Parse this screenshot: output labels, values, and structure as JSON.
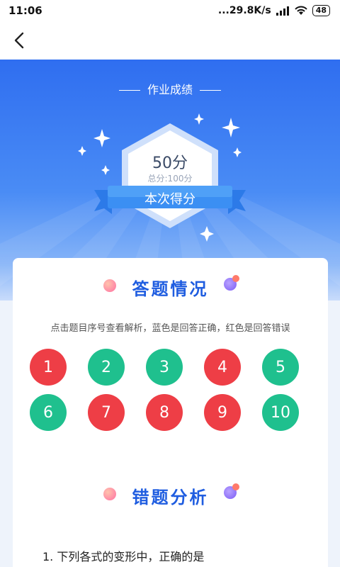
{
  "status_bar": {
    "time": "11:06",
    "network_speed": "...29.8K/s",
    "battery": "48"
  },
  "nav": {
    "back_icon": "chevron-left-icon"
  },
  "hero": {
    "title": "作业成绩",
    "score": "50分",
    "total": "总分:100分",
    "ribbon": "本次得分"
  },
  "answer_section": {
    "title": "答题情况",
    "hint": "点击题目序号查看解析，蓝色是回答正确，红色是回答错误",
    "items": [
      {
        "number": "1",
        "status": "wrong"
      },
      {
        "number": "2",
        "status": "correct"
      },
      {
        "number": "3",
        "status": "correct"
      },
      {
        "number": "4",
        "status": "wrong"
      },
      {
        "number": "5",
        "status": "correct"
      },
      {
        "number": "6",
        "status": "correct"
      },
      {
        "number": "7",
        "status": "wrong"
      },
      {
        "number": "8",
        "status": "wrong"
      },
      {
        "number": "9",
        "status": "wrong"
      },
      {
        "number": "10",
        "status": "correct"
      }
    ]
  },
  "error_section": {
    "title": "错题分析",
    "question": "1.  下列各式的变形中，正确的是"
  },
  "colors": {
    "correct": "#1fc08e",
    "wrong": "#ee3e46",
    "accent": "#1f5de0",
    "hero": "#2f6ef0"
  }
}
